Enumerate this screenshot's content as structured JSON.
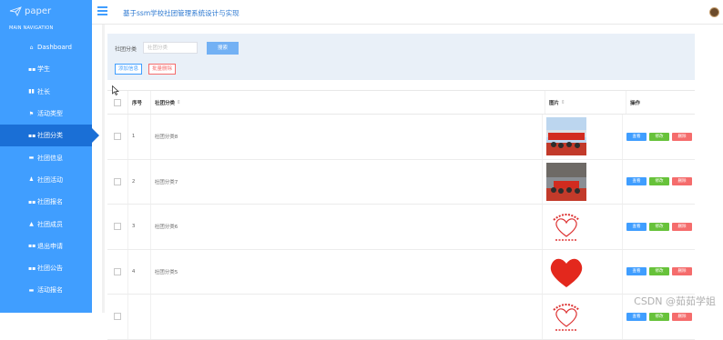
{
  "logo_text": "paper",
  "main_nav_label": "MAIN NAVIGATION",
  "app_title": "基于ssm学校社团管理系统设计与实现",
  "menu": [
    {
      "label": "Dashboard",
      "icon": "home-icon"
    },
    {
      "label": "学生",
      "icon": "grid-icon"
    },
    {
      "label": "社长",
      "icon": "bar-chart-icon"
    },
    {
      "label": "活动类型",
      "icon": "flag-icon"
    },
    {
      "label": "社团分类",
      "icon": "grid-icon",
      "active": true
    },
    {
      "label": "社团信息",
      "icon": "folder-icon"
    },
    {
      "label": "社团活动",
      "icon": "user-icon"
    },
    {
      "label": "社团报名",
      "icon": "grid-icon"
    },
    {
      "label": "社团成员",
      "icon": "lock-icon"
    },
    {
      "label": "退出申请",
      "icon": "grid-icon"
    },
    {
      "label": "社团公告",
      "icon": "grid-icon"
    },
    {
      "label": "活动报名",
      "icon": "card-icon"
    }
  ],
  "search": {
    "label": "社团分类",
    "placeholder": "社团分类",
    "button": "搜索"
  },
  "toolbar": {
    "add": "添加信息",
    "batch_delete": "批量删除"
  },
  "table": {
    "headers": {
      "no": "序号",
      "category": "社团分类",
      "image": "图片",
      "actions": "操作"
    },
    "rows": [
      {
        "no": "1",
        "category": "社团分类8",
        "image": "red-banner-crowd-photo"
      },
      {
        "no": "2",
        "category": "社团分类7",
        "image": "red-banner-building-photo"
      },
      {
        "no": "3",
        "category": "社团分类6",
        "image": "volunteer-heart-logo"
      },
      {
        "no": "4",
        "category": "社团分类5",
        "image": "volunteer-heart-logo-red"
      },
      {
        "no": "",
        "category": "",
        "image": "volunteer-heart-logo-partial"
      }
    ],
    "action_labels": {
      "view": "查看",
      "edit": "修改",
      "delete": "删除"
    }
  },
  "watermark": "CSDN @茹茹学姐",
  "colors": {
    "sidebar": "#409eff",
    "active": "#1a6fd6",
    "view": "#409eff",
    "edit": "#67c23a",
    "delete": "#f56c6c"
  }
}
